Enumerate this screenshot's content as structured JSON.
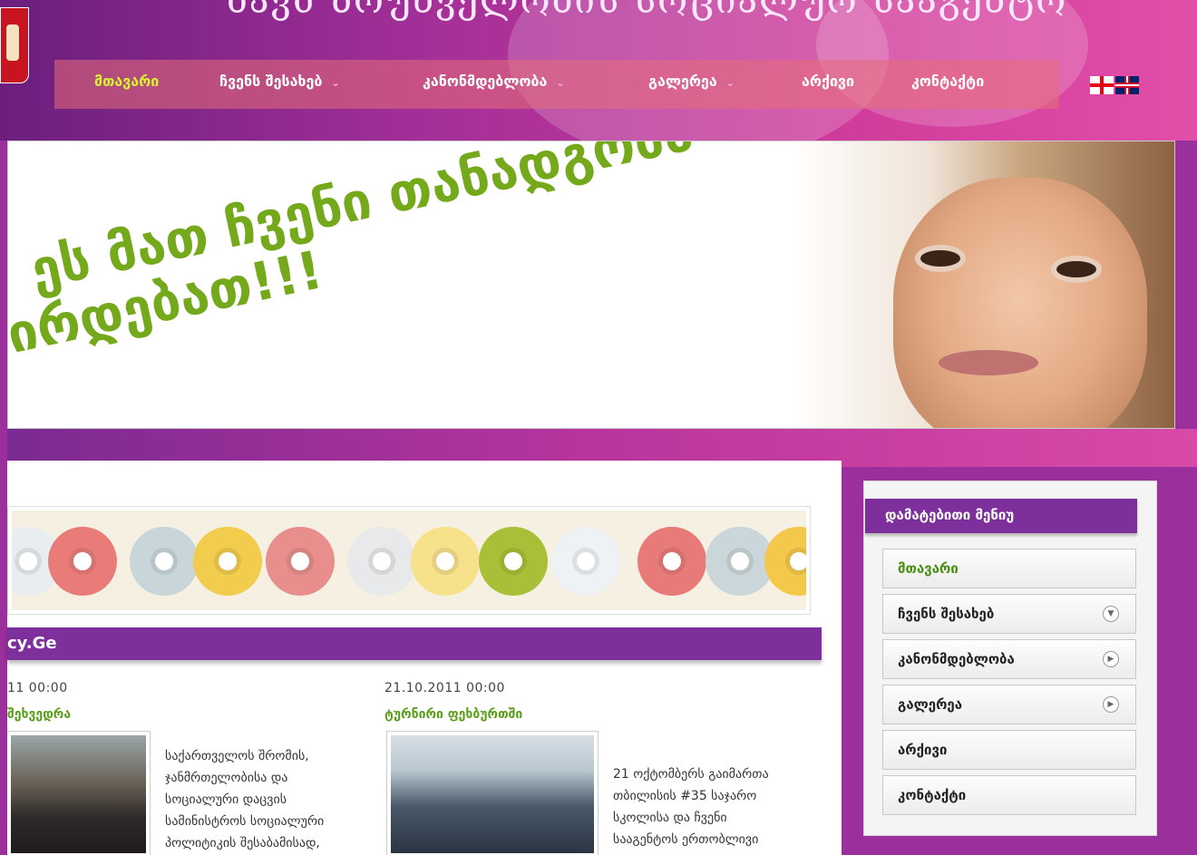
{
  "site": {
    "title": "ბავშ ზრუნველობის სოციალურ სააგენტო"
  },
  "nav": {
    "items": [
      {
        "label": "მთავარი",
        "active": true
      },
      {
        "label": "ჩვენს შესახებ",
        "has_submenu": true
      },
      {
        "label": "კანონმდებლობა",
        "has_submenu": true
      },
      {
        "label": "გალერეა",
        "has_submenu": true
      },
      {
        "label": "არქივი"
      },
      {
        "label": "კონტაქტი"
      }
    ],
    "caret": "⌄",
    "languages": [
      "georgian-flag-icon",
      "english-flag-icon"
    ]
  },
  "banner": {
    "slogan_line1": "ეს მათ ჩვენი თანადგომა",
    "slogan_line2": "ირდებათ!!!",
    "accent": "#74a91b"
  },
  "news": {
    "heading": "cy.Ge",
    "items": [
      {
        "date": "11 00:00",
        "title": "შეხვედრა",
        "text": [
          "საქართველოს შრომის,",
          "ჯანმრთელობისა და",
          "სოციალური დაცვის",
          "სამინისტროს სოციალური",
          "პოლიტიკის შესაბამისად,"
        ]
      },
      {
        "date": "21.10.2011 00:00",
        "title": "ტურნირი ფეხბურთში",
        "text": [
          "21 ოქტომბერს გაიმართა",
          "თბილისის #35 საჯარო",
          "სკოლისა და ჩვენი",
          "სააგენტოს ერთობლივი"
        ]
      }
    ]
  },
  "sidebar": {
    "title": "დამატებითი მენიუ",
    "items": [
      {
        "label": "მთავარი",
        "active": true
      },
      {
        "label": "ჩვენს შესახებ",
        "icon": "chevron-down-icon",
        "glyph": "▼"
      },
      {
        "label": "კანონმდებლობა",
        "icon": "chevron-right-icon",
        "glyph": "▶"
      },
      {
        "label": "გალერეა",
        "icon": "chevron-right-icon",
        "glyph": "▶"
      },
      {
        "label": "არქივი"
      },
      {
        "label": "კონტაქტი"
      }
    ]
  },
  "colors": {
    "purple": "#7d2f9c",
    "green": "#5a9e1a",
    "lime_active": "#d7f233"
  }
}
